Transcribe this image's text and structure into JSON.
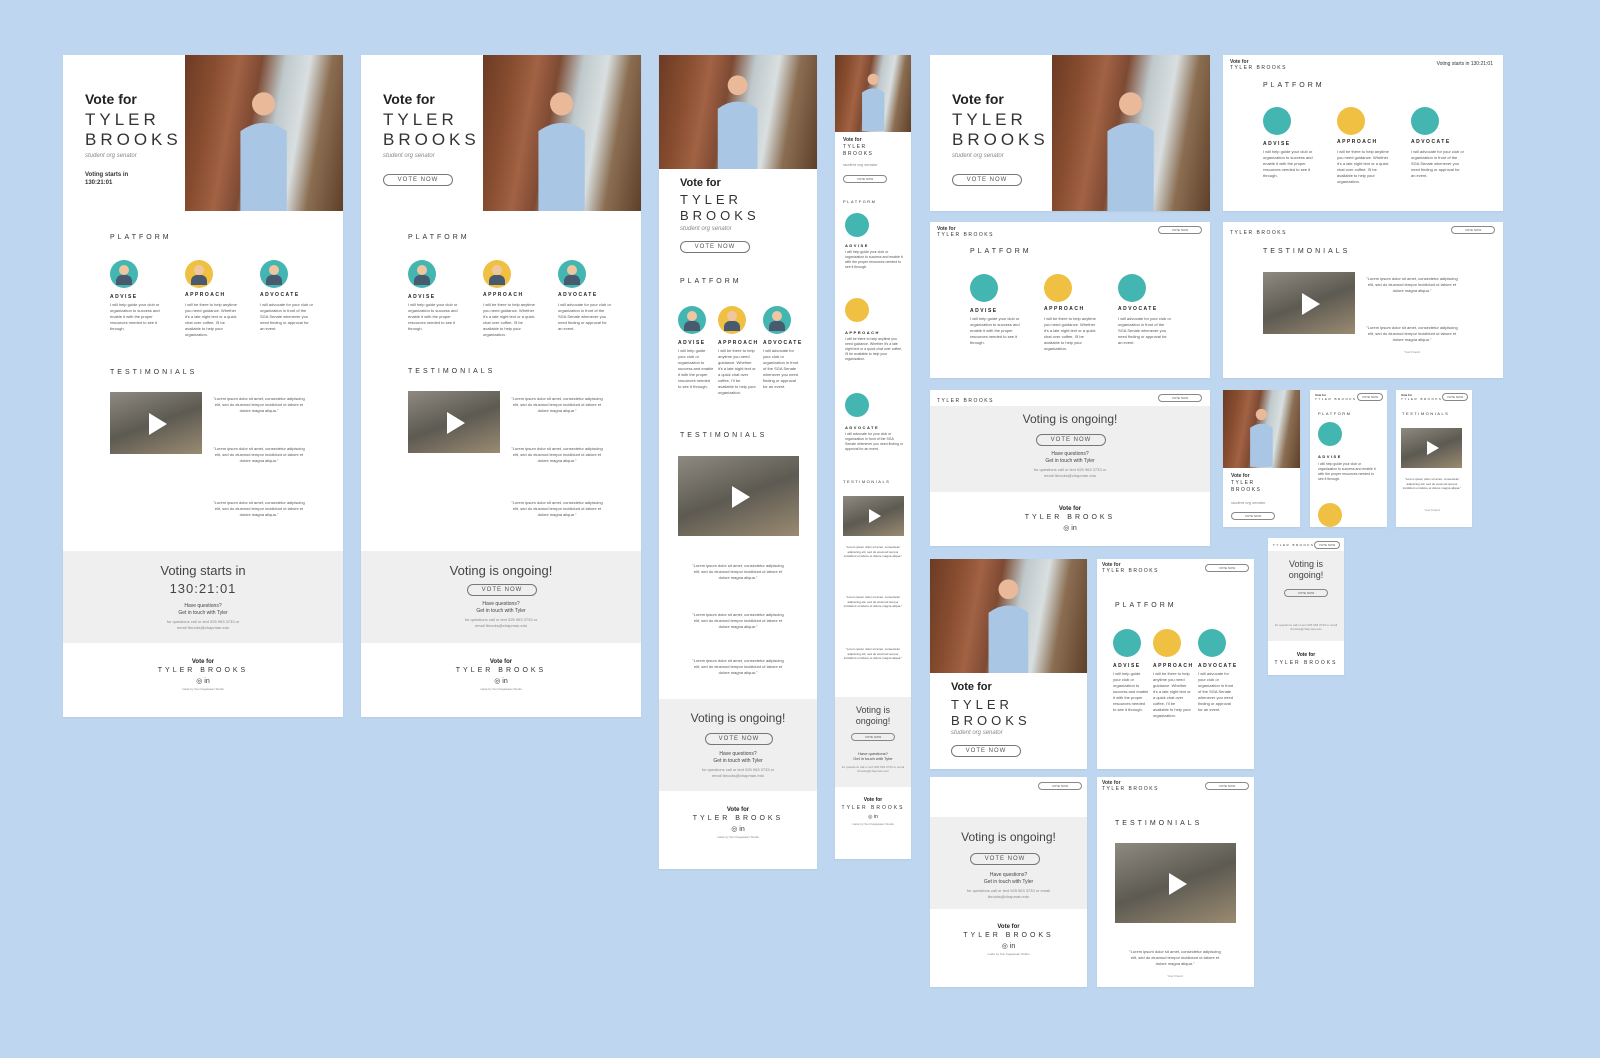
{
  "brand": {
    "vote_for": "Vote for",
    "name": "TYLER BROOKS",
    "tagline": "student org senator"
  },
  "hero": {
    "countdown_label": "Voting starts in",
    "countdown": "130:21:01",
    "vote_button": "VOTE NOW"
  },
  "platform": {
    "heading": "PLATFORM",
    "items": [
      {
        "label": "ADVISE",
        "text": "I will help guide your club or organization to success and enable it with the proper resources needed to see it through."
      },
      {
        "label": "APPROACH",
        "text": "I will be there to help anytime you need guidance. Whether it's a late night text or a quick chat over coffee, I'll be available to help your organization."
      },
      {
        "label": "ADVOCATE",
        "text": "I will advocate for your club or organization in front of the SGA Senate whenever you need finding or approval for an event."
      }
    ]
  },
  "testimonials": {
    "heading": "TESTIMONIALS",
    "quote": "\"Lorem ipsum dolor sit amet, consectetur adipiscing elit, sed do eiusmod tempor incididunt ut labore et dolore magna aliqua.\"",
    "author": "Your Friend"
  },
  "cta": {
    "starts_title": "Voting starts in",
    "ongoing_title": "Voting is ongoing!",
    "ongoing_short": "Voting is ongoing!",
    "button": "VOTE NOW",
    "questions": "Have questions?",
    "contact": "Get in touch with Tyler",
    "fine_print": "for questions call or text 925 963 3733 or email tbrooks@chapman.edu"
  },
  "footer": {
    "vote_for": "Vote for",
    "name": "TYLER BROOKS",
    "social": "◎ in",
    "fine": "made by Sun Kagawaan Studio"
  },
  "colors": {
    "background": "#bed6ef",
    "teal": "#44b6b1",
    "gold": "#efc042",
    "cta_bg": "#efefef"
  }
}
